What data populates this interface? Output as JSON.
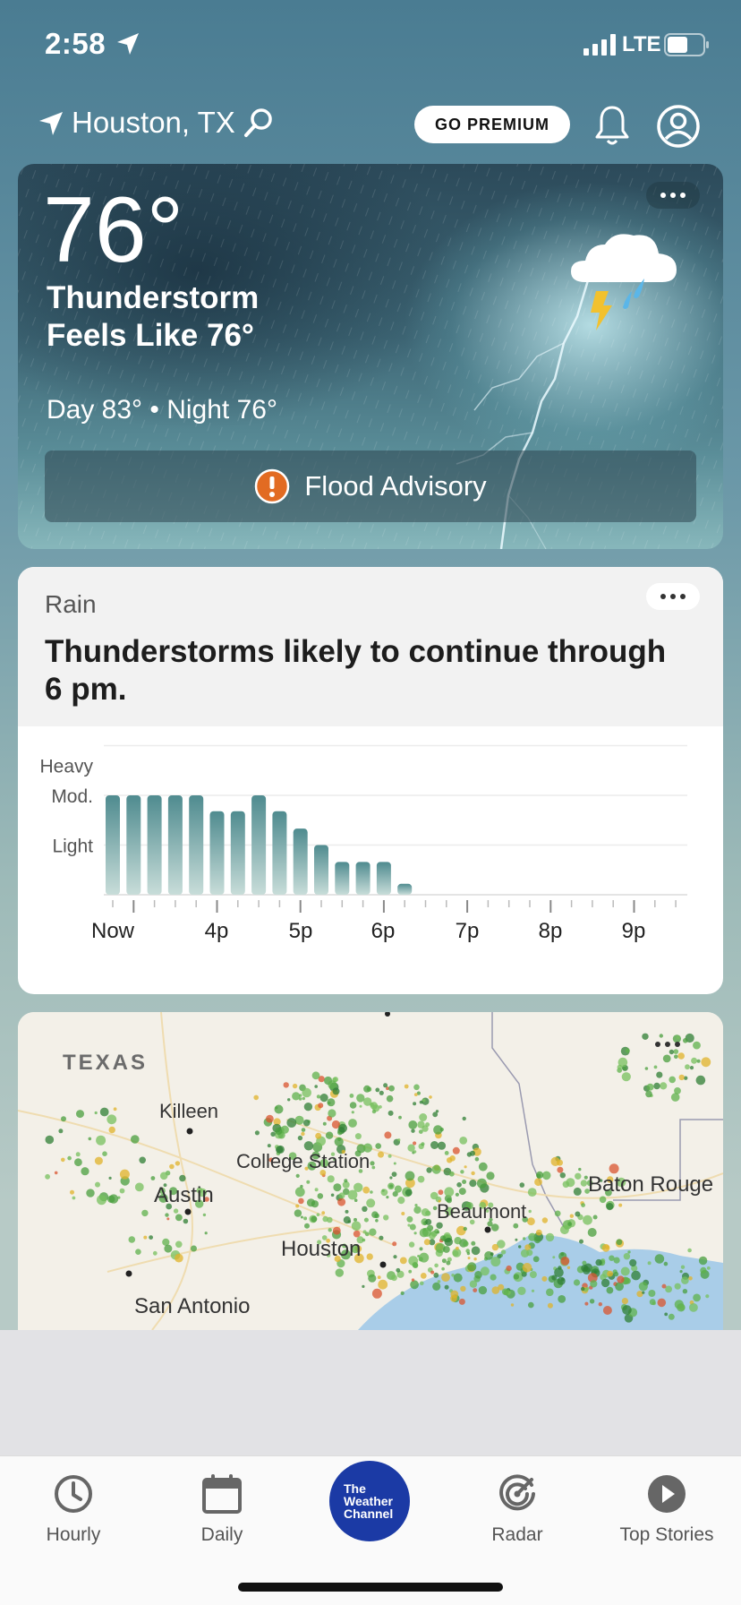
{
  "status_bar": {
    "time": "2:58",
    "network": "LTE"
  },
  "header": {
    "location": "Houston, TX",
    "premium_label": "GO PREMIUM"
  },
  "current": {
    "temperature": "76°",
    "condition": "Thunderstorm",
    "feels_like": "Feels Like 76°",
    "day_night": "Day 83° • Night 76°",
    "alert": "Flood Advisory"
  },
  "rain": {
    "title": "Rain",
    "summary": "Thunderstorms likely to continue through 6 pm."
  },
  "chart_data": {
    "type": "bar",
    "y_levels": [
      "Heavy",
      "Mod.",
      "Light"
    ],
    "x_ticks": [
      "Now",
      "4p",
      "5p",
      "6p",
      "7p",
      "8p",
      "9p"
    ],
    "values": [
      2.0,
      2.0,
      2.0,
      2.0,
      2.0,
      1.68,
      1.68,
      2.0,
      1.68,
      1.33,
      1.0,
      0.66,
      0.66,
      0.66,
      0.22
    ],
    "ylim": [
      0,
      3
    ],
    "interval_minutes": 10
  },
  "map": {
    "labels": [
      {
        "text": "TEXAS"
      },
      {
        "text": "Killeen"
      },
      {
        "text": "College Station"
      },
      {
        "text": "Austin"
      },
      {
        "text": "Baton Rouge"
      },
      {
        "text": "Beaumont"
      },
      {
        "text": "Houston"
      },
      {
        "text": "San Antonio"
      }
    ]
  },
  "tabs": {
    "hourly": "Hourly",
    "daily": "Daily",
    "logo_lines": [
      "The",
      "Weather",
      "Channel"
    ],
    "radar": "Radar",
    "stories": "Top Stories"
  },
  "colors": {
    "accent": "#1b3aa5",
    "bar_top": "#4f8b8f",
    "bar_bottom": "#c8ddd9",
    "alert": "#e26b22"
  }
}
